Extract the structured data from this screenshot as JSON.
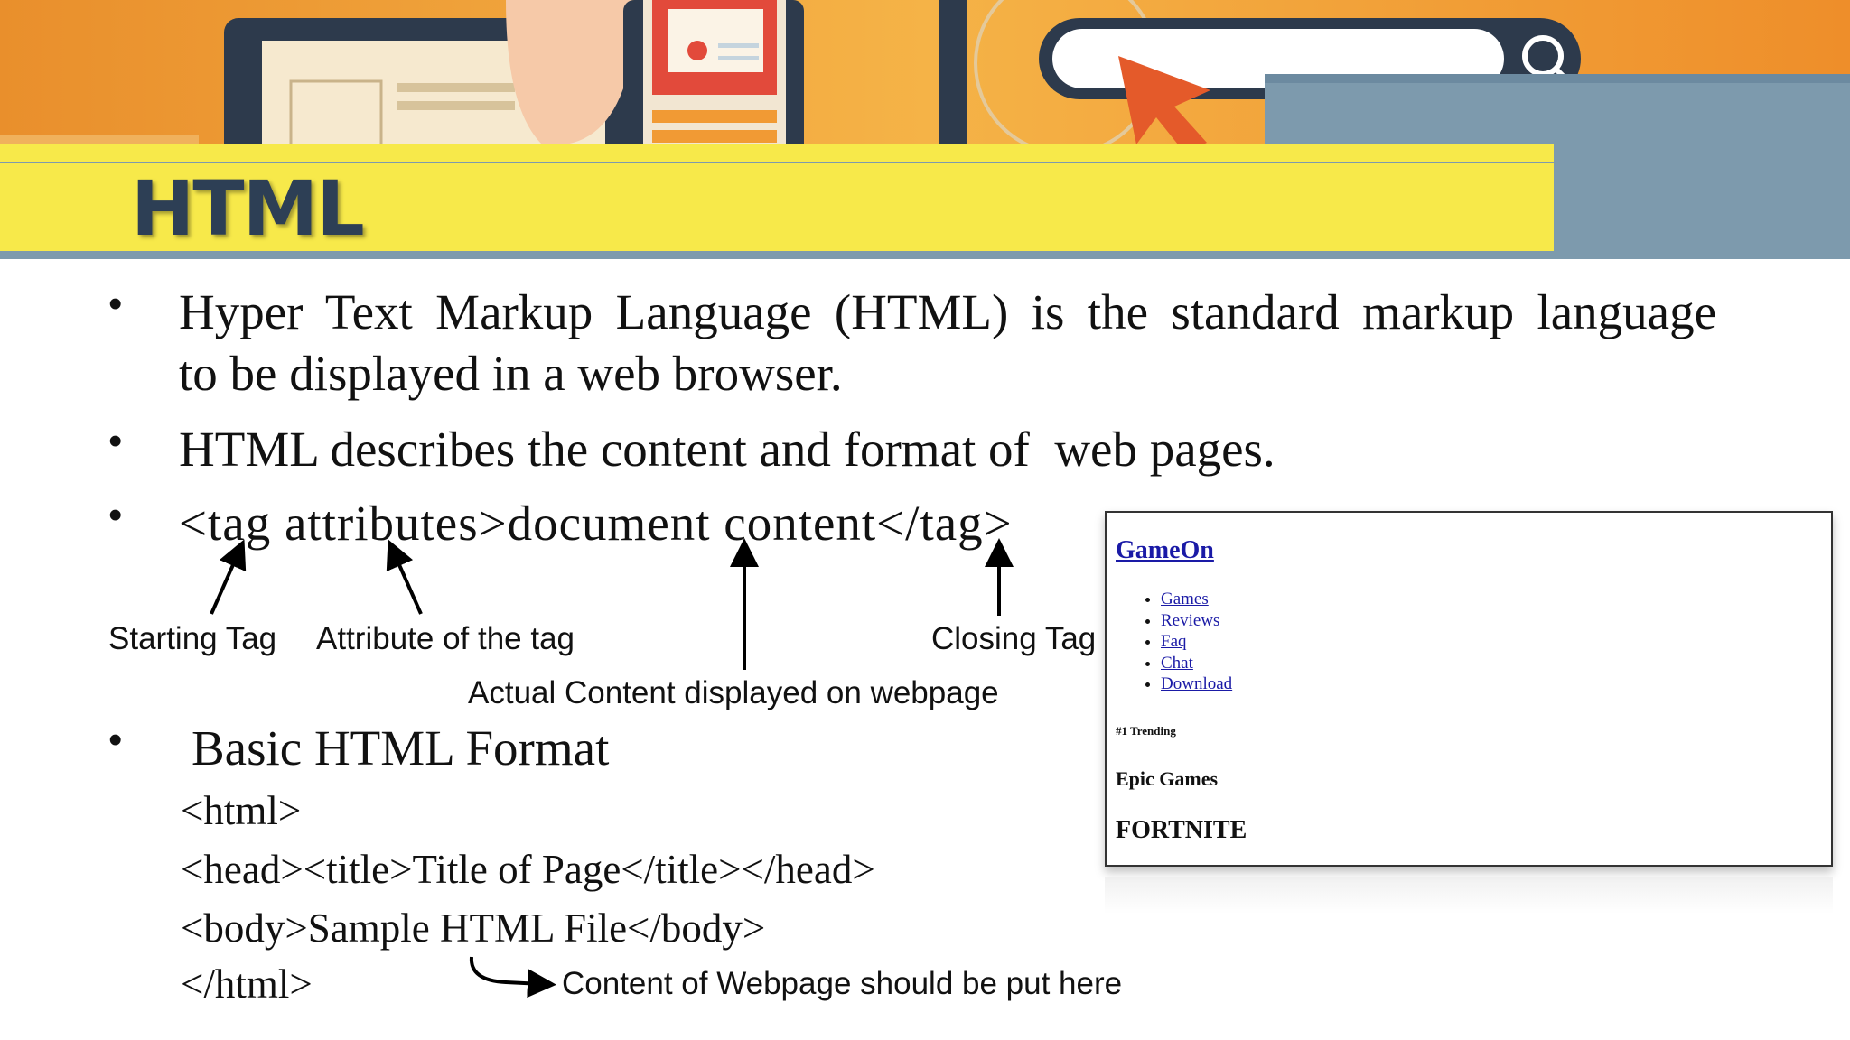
{
  "slide": {
    "title": "HTML",
    "bullets": [
      {
        "line1": "Hyper Text Markup Language (HTML) is the standard markup language",
        "line2": "to be displayed in a web browser."
      },
      {
        "text": "HTML describes the content and format of  web pages."
      },
      {
        "text": "<tag attributes>document content</tag>"
      },
      {
        "text": "Basic HTML Format"
      }
    ],
    "bullet_symbol": "•",
    "annotations": {
      "starting_tag": "Starting Tag",
      "attribute": "Attribute of the tag",
      "closing_tag": "Closing Tag",
      "actual_content": "Actual Content displayed on webpage",
      "content_note": "Content of Webpage should be put here"
    },
    "code_lines": [
      "<html>",
      "<head><title>Title of Page</title></head>",
      "<body>Sample HTML File</body>",
      "</html>"
    ]
  },
  "preview": {
    "site_title": "GameOn",
    "nav_links": [
      "Games",
      "Reviews",
      "Faq",
      "Chat",
      "Download"
    ],
    "trending": "#1 Trending",
    "subheading": "Epic Games",
    "heading": "FORTNITE"
  },
  "colors": {
    "banner_orange": "#f2a23a",
    "title_bar_yellow": "#f7e94a",
    "title_text": "#2d3f55",
    "accent_blue": "#7d9aad",
    "link_blue": "#1a1aa6"
  }
}
